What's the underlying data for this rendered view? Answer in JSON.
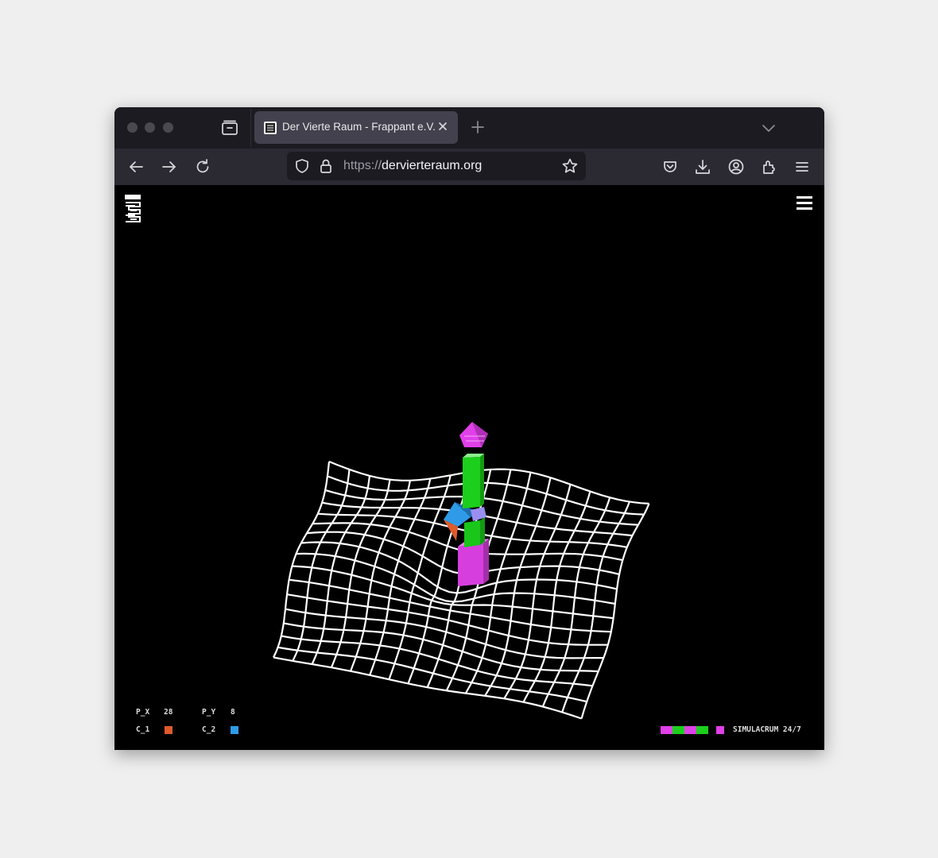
{
  "browser": {
    "tab": {
      "title": "Der Vierte Raum - Frappant e.V."
    },
    "url": {
      "scheme": "https://",
      "host": "dervierteraum.org"
    }
  },
  "hud": {
    "px": {
      "label": "P_X",
      "value": "28"
    },
    "py": {
      "label": "P_Y",
      "value": "8"
    },
    "c1": {
      "label": "C_1",
      "color": "#e05a2b"
    },
    "c2": {
      "label": "C_2",
      "color": "#2f9be8"
    },
    "status": {
      "text": "SIMULACRUM 24/7",
      "bar_colors": [
        "#e040e8",
        "#1ccf1c",
        "#e040e8",
        "#1ccf1c"
      ],
      "square_color": "#e040e8"
    }
  },
  "icons": {
    "tab_list": "tab-list-icon",
    "close": "close-icon",
    "new_tab": "plus-icon",
    "overflow": "chevron-down-icon",
    "back": "back-arrow-icon",
    "forward": "forward-arrow-icon",
    "reload": "reload-icon",
    "shield": "shield-icon",
    "lock": "lock-icon",
    "bookmark": "star-icon",
    "pocket": "pocket-icon",
    "downloads": "download-icon",
    "account": "account-icon",
    "extensions": "extensions-icon",
    "app_menu": "hamburger-menu-icon",
    "site_logo": "site-logo-icon",
    "site_menu": "site-menu-icon"
  },
  "scene": {
    "grid_color": "#ffffff",
    "magenta": "#e040e8",
    "green": "#1ccf1c",
    "blue": "#2f9be8",
    "orange": "#e05a2b"
  }
}
